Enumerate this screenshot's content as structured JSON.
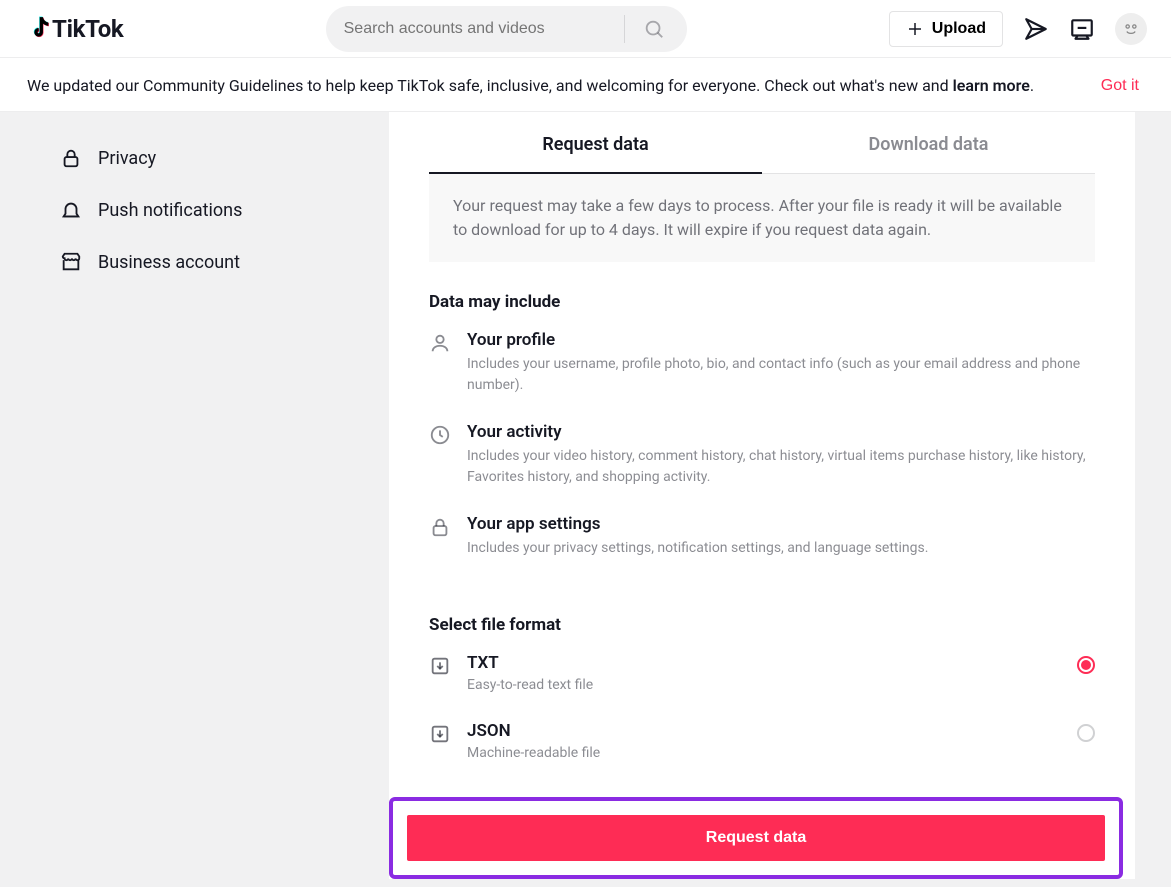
{
  "header": {
    "logo_text": "TikTok",
    "search_placeholder": "Search accounts and videos",
    "upload_label": "Upload"
  },
  "banner": {
    "text_prefix": "We updated our Community Guidelines to help keep TikTok safe, inclusive, and welcoming for everyone. Check out what's new and ",
    "learn_more": "learn more",
    "period": ".",
    "dismiss": "Got it"
  },
  "sidebar": {
    "items": [
      {
        "label": "Privacy"
      },
      {
        "label": "Push notifications"
      },
      {
        "label": "Business account"
      }
    ]
  },
  "tabs": {
    "request": "Request data",
    "download": "Download data"
  },
  "info_banner": "Your request may take a few days to process. After your file is ready it will be available to download for up to 4 days. It will expire if you request data again.",
  "data_include": {
    "heading": "Data may include",
    "items": [
      {
        "title": "Your profile",
        "desc": "Includes your username, profile photo, bio, and contact info (such as your email address and phone number)."
      },
      {
        "title": "Your activity",
        "desc": "Includes your video history, comment history, chat history, virtual items purchase history, like history, Favorites history, and shopping activity."
      },
      {
        "title": "Your app settings",
        "desc": "Includes your privacy settings, notification settings, and language settings."
      }
    ]
  },
  "file_format": {
    "heading": "Select file format",
    "options": [
      {
        "title": "TXT",
        "desc": "Easy-to-read text file",
        "selected": true
      },
      {
        "title": "JSON",
        "desc": "Machine-readable file",
        "selected": false
      }
    ]
  },
  "request_button": "Request data"
}
